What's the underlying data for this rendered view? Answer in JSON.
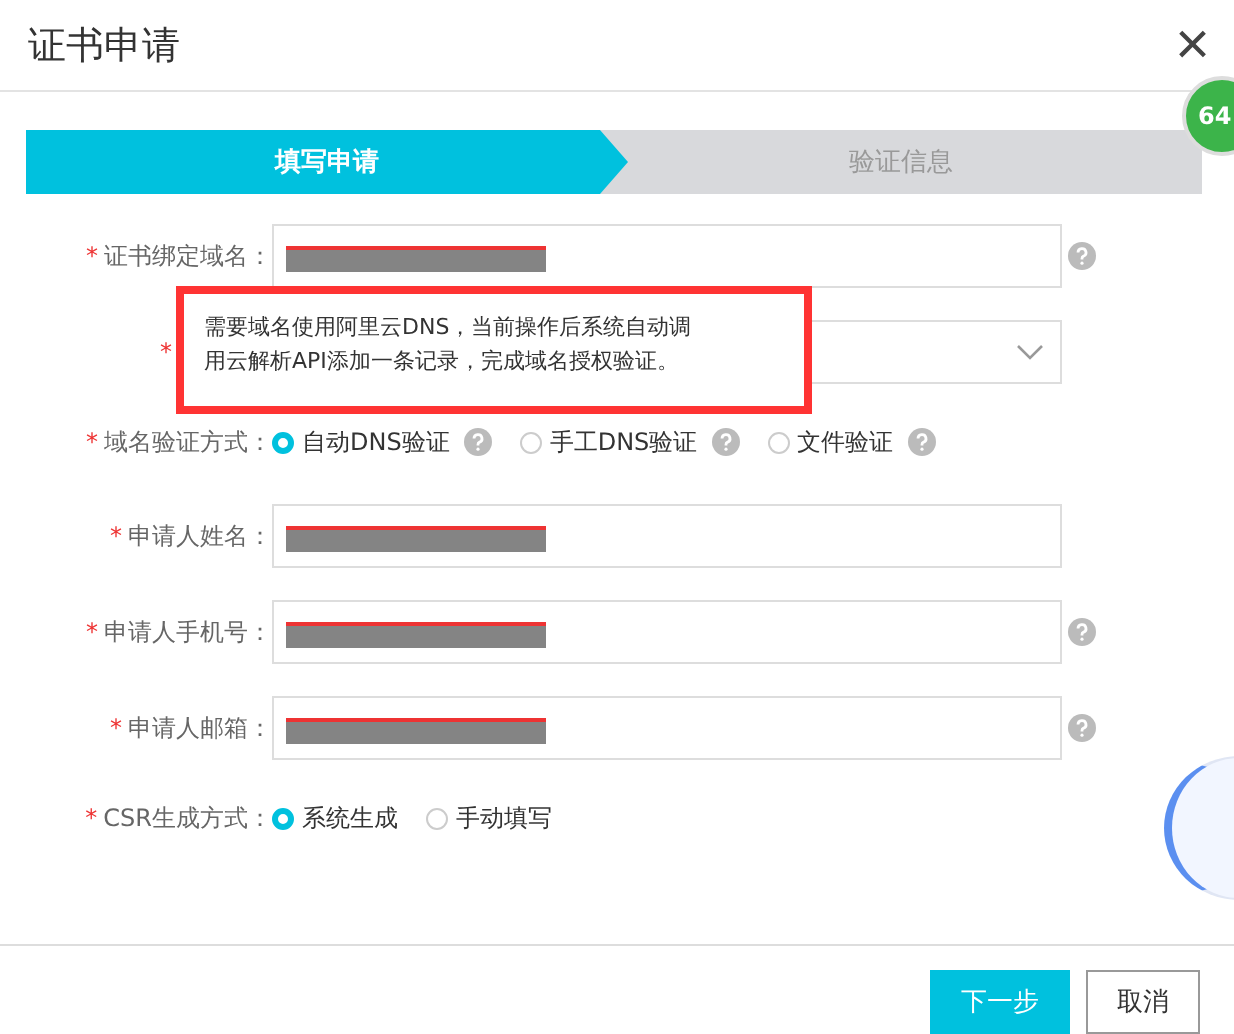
{
  "dialog": {
    "title": "证书申请",
    "close": "×"
  },
  "steps": [
    {
      "label": "填写申请",
      "selected": true
    },
    {
      "label": "验证信息",
      "selected": false
    }
  ],
  "fields": [
    {
      "kind": "input",
      "label": "证书绑定域名：",
      "required_mark": "*",
      "redacted": true,
      "help": true
    },
    {
      "kind": "select",
      "required_mark": "*",
      "redacted": false,
      "help": false
    },
    {
      "kind": "radio",
      "label": "域名验证方式：",
      "required_mark": "*",
      "options": [
        {
          "label": "自动DNS验证",
          "selected": true,
          "help": true
        },
        {
          "label": "手工DNS验证",
          "selected": false,
          "help": true
        },
        {
          "label": "文件验证",
          "selected": false,
          "help": true
        }
      ]
    },
    {
      "kind": "input",
      "label": "申请人姓名：",
      "required_mark": "*",
      "redacted": true,
      "help": false
    },
    {
      "kind": "input",
      "label": "申请人手机号：",
      "required_mark": "*",
      "redacted": true,
      "help": true
    },
    {
      "kind": "input",
      "label": "申请人邮箱：",
      "required_mark": "*",
      "redacted": true,
      "help": true
    },
    {
      "kind": "radio",
      "label": "CSR生成方式：",
      "required_mark": "*",
      "options": [
        {
          "label": "系统生成",
          "selected": true,
          "help": false
        },
        {
          "label": "手动填写",
          "selected": false,
          "help": false
        }
      ]
    }
  ],
  "tooltip": {
    "text": "需要域名使用阿里云DNS，当前操作后系统自动调用云解析API添加一条记录，完成域名授权验证。"
  },
  "badge": {
    "text": "64"
  },
  "buttons": [
    {
      "label": "下一步",
      "kind": "primary"
    },
    {
      "label": "取消",
      "kind": "default"
    }
  ]
}
